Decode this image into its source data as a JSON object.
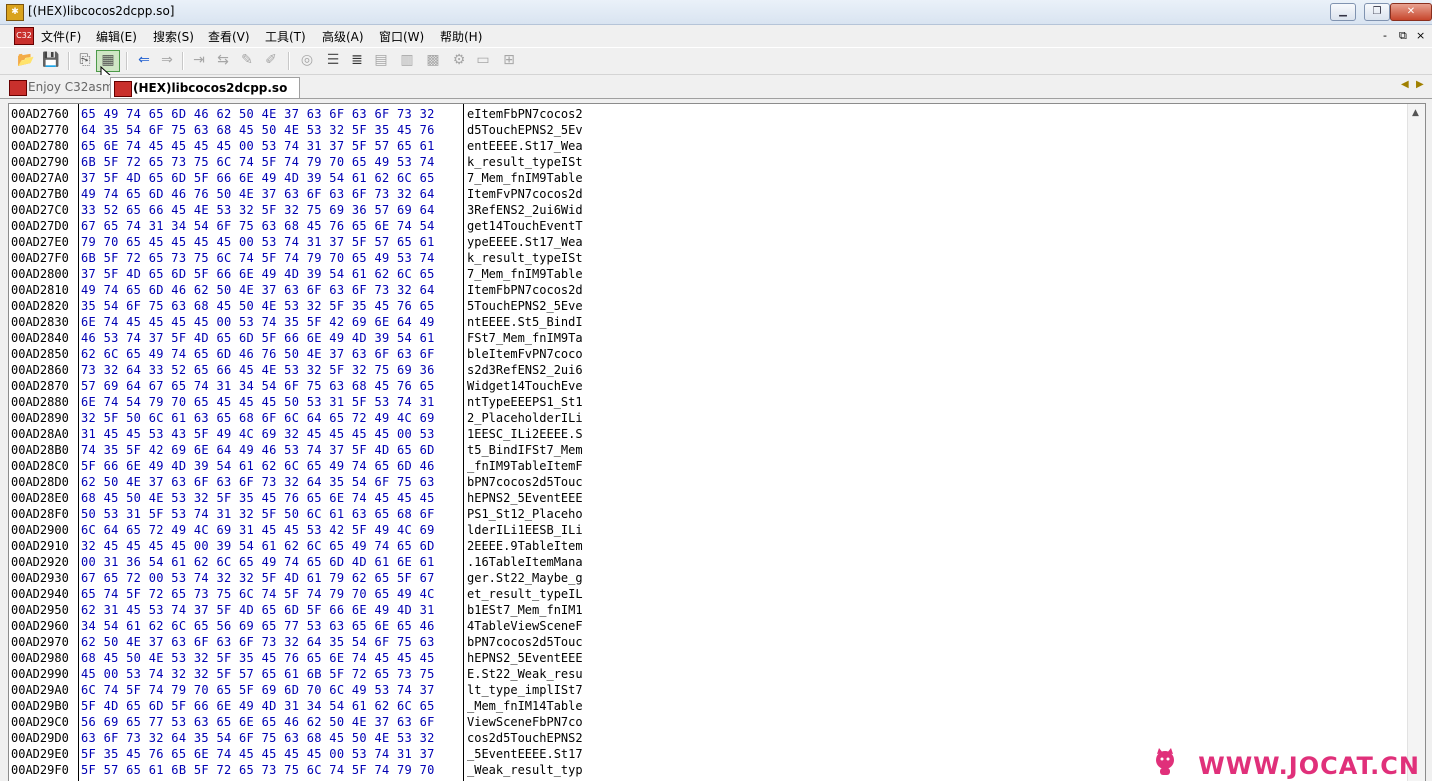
{
  "window": {
    "title": "[(HEX)libcocos2dcpp.so]",
    "icon_text": "C32",
    "controls": [
      "min-icon",
      "restore-icon",
      "close-icon"
    ]
  },
  "menu": {
    "items": [
      "文件(F)",
      "编辑(E)",
      "搜索(S)",
      "查看(V)",
      "工具(T)",
      "高级(A)",
      "窗口(W)",
      "帮助(H)"
    ],
    "mdi_controls": [
      "-",
      "⧉",
      "×"
    ]
  },
  "tabs": {
    "inactive_label": "Enjoy C32asm",
    "active_label": "(HEX)libcocos2dcpp.so"
  },
  "hex_rows": [
    {
      "addr": "00AD2760",
      "bytes": "65 49 74 65 6D 46 62 50 4E 37 63 6F 63 6F 73 32",
      "ascii": "eItemFbPN7cocos2"
    },
    {
      "addr": "00AD2770",
      "bytes": "64 35 54 6F 75 63 68 45 50 4E 53 32 5F 35 45 76",
      "ascii": "d5TouchEPNS2_5Ev"
    },
    {
      "addr": "00AD2780",
      "bytes": "65 6E 74 45 45 45 45 00 53 74 31 37 5F 57 65 61",
      "ascii": "entEEEE.St17_Wea"
    },
    {
      "addr": "00AD2790",
      "bytes": "6B 5F 72 65 73 75 6C 74 5F 74 79 70 65 49 53 74",
      "ascii": "k_result_typeISt"
    },
    {
      "addr": "00AD27A0",
      "bytes": "37 5F 4D 65 6D 5F 66 6E 49 4D 39 54 61 62 6C 65",
      "ascii": "7_Mem_fnIM9Table"
    },
    {
      "addr": "00AD27B0",
      "bytes": "49 74 65 6D 46 76 50 4E 37 63 6F 63 6F 73 32 64",
      "ascii": "ItemFvPN7cocos2d"
    },
    {
      "addr": "00AD27C0",
      "bytes": "33 52 65 66 45 4E 53 32 5F 32 75 69 36 57 69 64",
      "ascii": "3RefENS2_2ui6Wid"
    },
    {
      "addr": "00AD27D0",
      "bytes": "67 65 74 31 34 54 6F 75 63 68 45 76 65 6E 74 54",
      "ascii": "get14TouchEventT"
    },
    {
      "addr": "00AD27E0",
      "bytes": "79 70 65 45 45 45 45 00 53 74 31 37 5F 57 65 61",
      "ascii": "ypeEEEE.St17_Wea"
    },
    {
      "addr": "00AD27F0",
      "bytes": "6B 5F 72 65 73 75 6C 74 5F 74 79 70 65 49 53 74",
      "ascii": "k_result_typeISt"
    },
    {
      "addr": "00AD2800",
      "bytes": "37 5F 4D 65 6D 5F 66 6E 49 4D 39 54 61 62 6C 65",
      "ascii": "7_Mem_fnIM9Table"
    },
    {
      "addr": "00AD2810",
      "bytes": "49 74 65 6D 46 62 50 4E 37 63 6F 63 6F 73 32 64",
      "ascii": "ItemFbPN7cocos2d"
    },
    {
      "addr": "00AD2820",
      "bytes": "35 54 6F 75 63 68 45 50 4E 53 32 5F 35 45 76 65",
      "ascii": "5TouchEPNS2_5Eve"
    },
    {
      "addr": "00AD2830",
      "bytes": "6E 74 45 45 45 45 00 53 74 35 5F 42 69 6E 64 49",
      "ascii": "ntEEEE.St5_BindI"
    },
    {
      "addr": "00AD2840",
      "bytes": "46 53 74 37 5F 4D 65 6D 5F 66 6E 49 4D 39 54 61",
      "ascii": "FSt7_Mem_fnIM9Ta"
    },
    {
      "addr": "00AD2850",
      "bytes": "62 6C 65 49 74 65 6D 46 76 50 4E 37 63 6F 63 6F",
      "ascii": "bleItemFvPN7coco"
    },
    {
      "addr": "00AD2860",
      "bytes": "73 32 64 33 52 65 66 45 4E 53 32 5F 32 75 69 36",
      "ascii": "s2d3RefENS2_2ui6"
    },
    {
      "addr": "00AD2870",
      "bytes": "57 69 64 67 65 74 31 34 54 6F 75 63 68 45 76 65",
      "ascii": "Widget14TouchEve"
    },
    {
      "addr": "00AD2880",
      "bytes": "6E 74 54 79 70 65 45 45 45 50 53 31 5F 53 74 31",
      "ascii": "ntTypeEEEPS1_St1"
    },
    {
      "addr": "00AD2890",
      "bytes": "32 5F 50 6C 61 63 65 68 6F 6C 64 65 72 49 4C 69",
      "ascii": "2_PlaceholderILi"
    },
    {
      "addr": "00AD28A0",
      "bytes": "31 45 45 53 43 5F 49 4C 69 32 45 45 45 45 00 53",
      "ascii": "1EESC_ILi2EEEE.S"
    },
    {
      "addr": "00AD28B0",
      "bytes": "74 35 5F 42 69 6E 64 49 46 53 74 37 5F 4D 65 6D",
      "ascii": "t5_BindIFSt7_Mem"
    },
    {
      "addr": "00AD28C0",
      "bytes": "5F 66 6E 49 4D 39 54 61 62 6C 65 49 74 65 6D 46",
      "ascii": "_fnIM9TableItemF"
    },
    {
      "addr": "00AD28D0",
      "bytes": "62 50 4E 37 63 6F 63 6F 73 32 64 35 54 6F 75 63",
      "ascii": "bPN7cocos2d5Touc"
    },
    {
      "addr": "00AD28E0",
      "bytes": "68 45 50 4E 53 32 5F 35 45 76 65 6E 74 45 45 45",
      "ascii": "hEPNS2_5EventEEE"
    },
    {
      "addr": "00AD28F0",
      "bytes": "50 53 31 5F 53 74 31 32 5F 50 6C 61 63 65 68 6F",
      "ascii": "PS1_St12_Placeho"
    },
    {
      "addr": "00AD2900",
      "bytes": "6C 64 65 72 49 4C 69 31 45 45 53 42 5F 49 4C 69",
      "ascii": "lderILi1EESB_ILi"
    },
    {
      "addr": "00AD2910",
      "bytes": "32 45 45 45 45 00 39 54 61 62 6C 65 49 74 65 6D",
      "ascii": "2EEEE.9TableItem"
    },
    {
      "addr": "00AD2920",
      "bytes": "00 31 36 54 61 62 6C 65 49 74 65 6D 4D 61 6E 61",
      "ascii": ".16TableItemMana"
    },
    {
      "addr": "00AD2930",
      "bytes": "67 65 72 00 53 74 32 32 5F 4D 61 79 62 65 5F 67",
      "ascii": "ger.St22_Maybe_g"
    },
    {
      "addr": "00AD2940",
      "bytes": "65 74 5F 72 65 73 75 6C 74 5F 74 79 70 65 49 4C",
      "ascii": "et_result_typeIL"
    },
    {
      "addr": "00AD2950",
      "bytes": "62 31 45 53 74 37 5F 4D 65 6D 5F 66 6E 49 4D 31",
      "ascii": "b1ESt7_Mem_fnIM1"
    },
    {
      "addr": "00AD2960",
      "bytes": "34 54 61 62 6C 65 56 69 65 77 53 63 65 6E 65 46",
      "ascii": "4TableViewSceneF"
    },
    {
      "addr": "00AD2970",
      "bytes": "62 50 4E 37 63 6F 63 6F 73 32 64 35 54 6F 75 63",
      "ascii": "bPN7cocos2d5Touc"
    },
    {
      "addr": "00AD2980",
      "bytes": "68 45 50 4E 53 32 5F 35 45 76 65 6E 74 45 45 45",
      "ascii": "hEPNS2_5EventEEE"
    },
    {
      "addr": "00AD2990",
      "bytes": "45 00 53 74 32 32 5F 57 65 61 6B 5F 72 65 73 75",
      "ascii": "E.St22_Weak_resu"
    },
    {
      "addr": "00AD29A0",
      "bytes": "6C 74 5F 74 79 70 65 5F 69 6D 70 6C 49 53 74 37",
      "ascii": "lt_type_implISt7"
    },
    {
      "addr": "00AD29B0",
      "bytes": "5F 4D 65 6D 5F 66 6E 49 4D 31 34 54 61 62 6C 65",
      "ascii": "_Mem_fnIM14Table"
    },
    {
      "addr": "00AD29C0",
      "bytes": "56 69 65 77 53 63 65 6E 65 46 62 50 4E 37 63 6F",
      "ascii": "ViewSceneFbPN7co"
    },
    {
      "addr": "00AD29D0",
      "bytes": "63 6F 73 32 64 35 54 6F 75 63 68 45 50 4E 53 32",
      "ascii": "cos2d5TouchEPNS2"
    },
    {
      "addr": "00AD29E0",
      "bytes": "5F 35 45 76 65 6E 74 45 45 45 45 00 53 74 31 37",
      "ascii": "_5EventEEEE.St17"
    },
    {
      "addr": "00AD29F0",
      "bytes": "5F 57 65 61 6B 5F 72 65 73 75 6C 74 5F 74 79 70",
      "ascii": "_Weak_result_typ"
    }
  ],
  "watermark": "WWW.JOCAT.CN",
  "colors": {
    "hex_bytes": "#0000b4",
    "watermark": "#e0307a"
  }
}
